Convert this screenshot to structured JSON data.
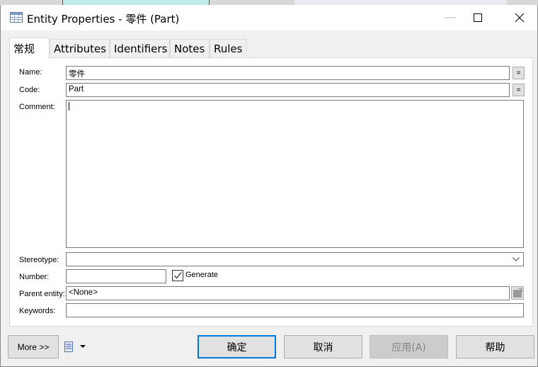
{
  "window": {
    "title": "Entity Properties - 零件 (Part)",
    "icon": "table-icon",
    "minimize": "—",
    "maximize": "☐",
    "close": "✕"
  },
  "tabs": [
    {
      "label": "常规",
      "active": true
    },
    {
      "label": "Attributes"
    },
    {
      "label": "Identifiers"
    },
    {
      "label": "Notes"
    },
    {
      "label": "Rules"
    }
  ],
  "form": {
    "name_label": "Name:",
    "name_value": "零件",
    "code_label": "Code:",
    "code_value": "Part",
    "equal_button": "=",
    "comment_label": "Comment:",
    "comment_value": "",
    "stereotype_label": "Stereotype:",
    "stereotype_value": "",
    "number_label": "Number:",
    "number_value": "",
    "generate_label": "Generate",
    "generate_checked": true,
    "parent_label": "Parent entity:",
    "parent_value": "<None>",
    "keywords_label": "Keywords:",
    "keywords_value": ""
  },
  "footer": {
    "more": "More >>",
    "ok": "确定",
    "cancel": "取消",
    "apply": "应用(A)",
    "help": "帮助"
  }
}
